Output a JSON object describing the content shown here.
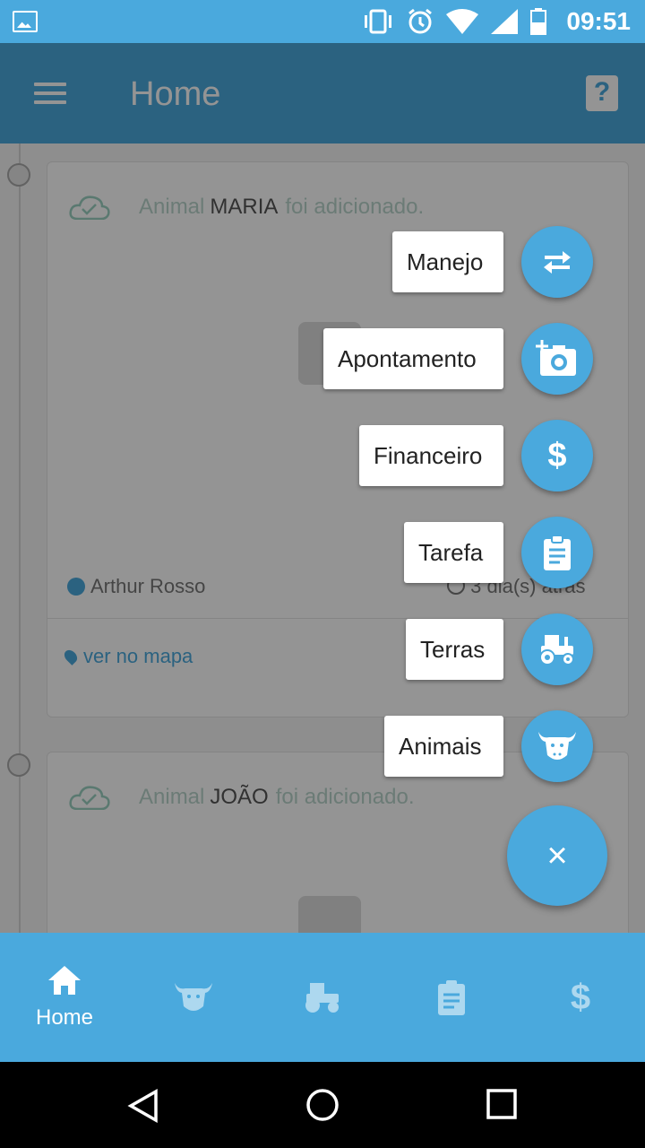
{
  "status_bar": {
    "time": "09:51"
  },
  "app_bar": {
    "title": "Home"
  },
  "feed": [
    {
      "prefix": "Animal",
      "name": "MARIA",
      "suffix": "foi adicionado.",
      "author": "Arthur Rosso",
      "time": "3 dia(s) atrás",
      "map_link": "ver no mapa"
    },
    {
      "prefix": "Animal",
      "name": "JOÃO",
      "suffix": "foi adicionado."
    }
  ],
  "fab_menu": [
    {
      "label": "Manejo",
      "icon": "swap-arrows-icon"
    },
    {
      "label": "Apontamento",
      "icon": "add-photo-icon"
    },
    {
      "label": "Financeiro",
      "icon": "dollar-icon"
    },
    {
      "label": "Tarefa",
      "icon": "clipboard-icon"
    },
    {
      "label": "Terras",
      "icon": "tractor-icon"
    },
    {
      "label": "Animais",
      "icon": "cow-icon"
    }
  ],
  "fab_main": {
    "icon": "close-icon",
    "glyph": "×"
  },
  "bottom_nav": [
    {
      "label": "Home",
      "icon": "home-icon",
      "active": true
    },
    {
      "icon": "cow-icon"
    },
    {
      "icon": "tractor-icon"
    },
    {
      "icon": "clipboard-icon"
    },
    {
      "icon": "dollar-icon"
    }
  ],
  "colors": {
    "primary": "#4aa9dd",
    "accent_green": "#9bd0c2"
  }
}
